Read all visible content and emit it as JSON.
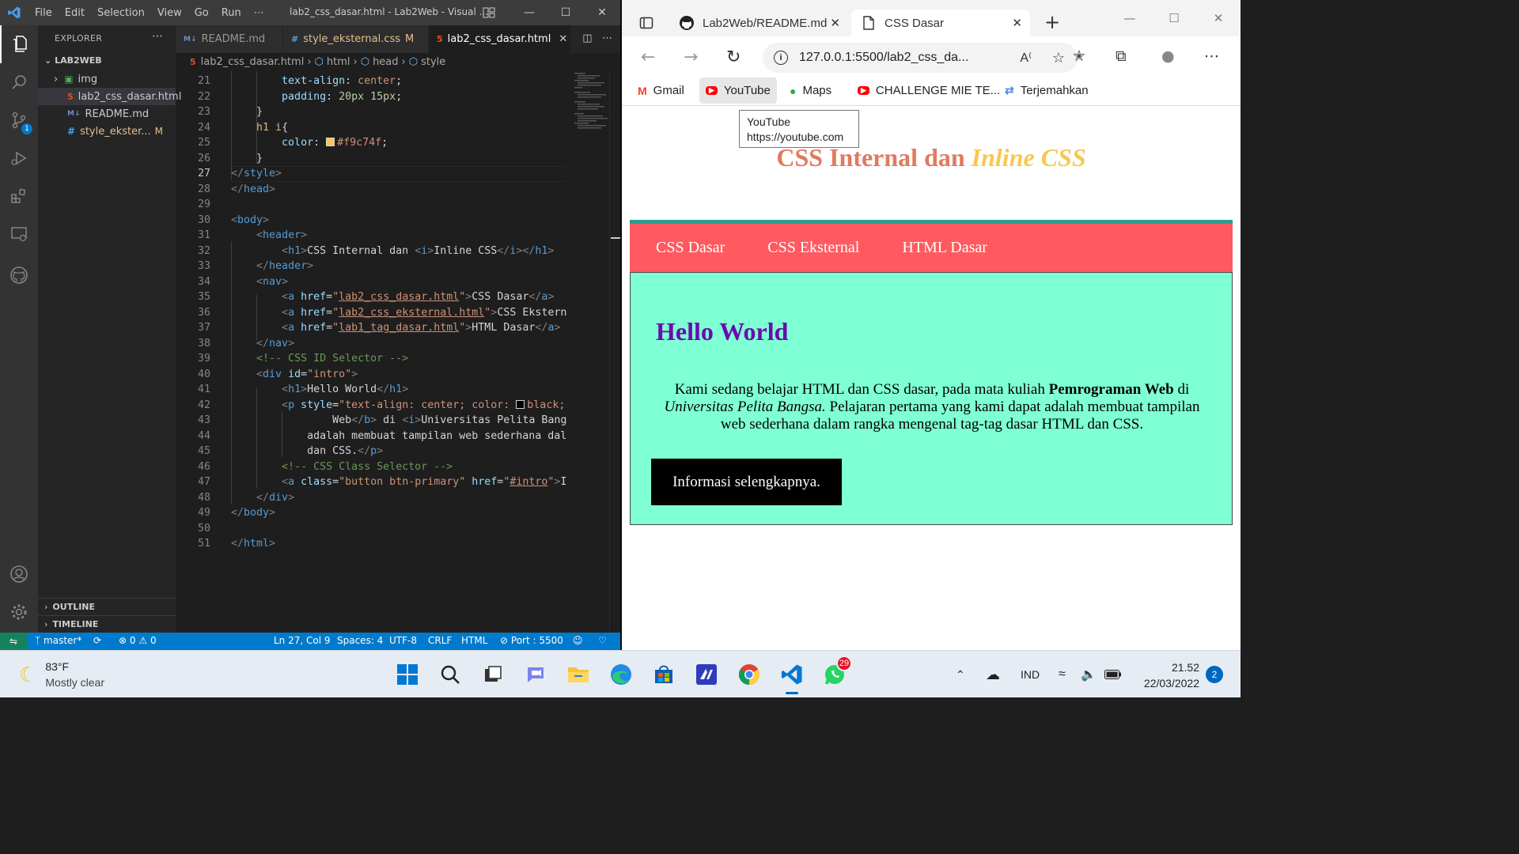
{
  "vscode": {
    "menu": [
      "File",
      "Edit",
      "Selection",
      "View",
      "Go",
      "Run",
      "⋯"
    ],
    "window_title": "lab2_css_dasar.html - Lab2Web - Visual ...",
    "explorer_title": "EXPLORER",
    "project": "LAB2WEB",
    "tree": [
      {
        "name": "img",
        "type": "folder"
      },
      {
        "name": "lab2_css_dasar.html",
        "type": "html"
      },
      {
        "name": "README.md",
        "type": "md"
      },
      {
        "name": "style_ekster...",
        "type": "css",
        "flag": "M"
      }
    ],
    "outline": "OUTLINE",
    "timeline": "TIMELINE",
    "tabs": [
      {
        "label": "README.md",
        "icon": "M↓"
      },
      {
        "label": "style_eksternal.css",
        "icon": "#",
        "flag": "M"
      },
      {
        "label": "lab2_css_dasar.html",
        "icon": "5"
      }
    ],
    "breadcrumb": [
      "lab2_css_dasar.html",
      "html",
      "head",
      "style"
    ],
    "status": {
      "branch": "master*",
      "errors": "0",
      "warnings": "0",
      "position": "Ln 27, Col 9",
      "spaces": "Spaces: 4",
      "encoding": "UTF-8",
      "eol": "CRLF",
      "language": "HTML",
      "port": "Port : 5500"
    },
    "line_numbers": [
      "21",
      "22",
      "23",
      "24",
      "25",
      "26",
      "27",
      "28",
      "29",
      "30",
      "31",
      "32",
      "33",
      "34",
      "35",
      "36",
      "37",
      "38",
      "39",
      "40",
      "41",
      "42",
      "43",
      "44",
      "45",
      "46",
      "47",
      "48",
      "49",
      "50",
      "51"
    ],
    "current_line": "27"
  },
  "browser": {
    "tabs": [
      {
        "label": "Lab2Web/README.md"
      },
      {
        "label": "CSS Dasar"
      }
    ],
    "url": "127.0.0.1:5500/lab2_css_da...",
    "favorites": [
      "Gmail",
      "YouTube",
      "Maps",
      "CHALLENGE MIE TE...",
      "Terjemahkan"
    ],
    "tooltip": {
      "title": "YouTube",
      "url": "https://youtube.com"
    },
    "page": {
      "h1_main": "CSS Internal dan ",
      "h1_italic": "Inline CSS",
      "nav": [
        "CSS Dasar",
        "CSS Eksternal",
        "HTML Dasar"
      ],
      "intro_heading": "Hello World",
      "p_part1": "Kami sedang belajar HTML dan CSS dasar, pada mata kuliah ",
      "p_bold": "Pemrograman Web",
      "p_part2": " di ",
      "p_italic": "Universitas Pelita Bangsa.",
      "p_part3": " Pelajaran pertama yang kami dapat adalah membuat tampilan web sederhana dalam rangka mengenal tag-tag dasar HTML dan CSS.",
      "button": "Informasi selengkapnya."
    }
  },
  "taskbar": {
    "temp": "83°F",
    "weather": "Mostly clear",
    "whatsapp_badge": "29",
    "lang": "IND",
    "time": "21.52",
    "date": "22/03/2022",
    "notifications": "2"
  },
  "colors": {
    "vscode_accent": "#007acc",
    "page_h1": "#e07a5f",
    "page_h1_italic": "#f9c74f",
    "nav_bg": "#ff5a5f",
    "nav_border": "#2a9d8f",
    "intro_bg": "#7fffd4",
    "hello": "#6a0dad"
  }
}
